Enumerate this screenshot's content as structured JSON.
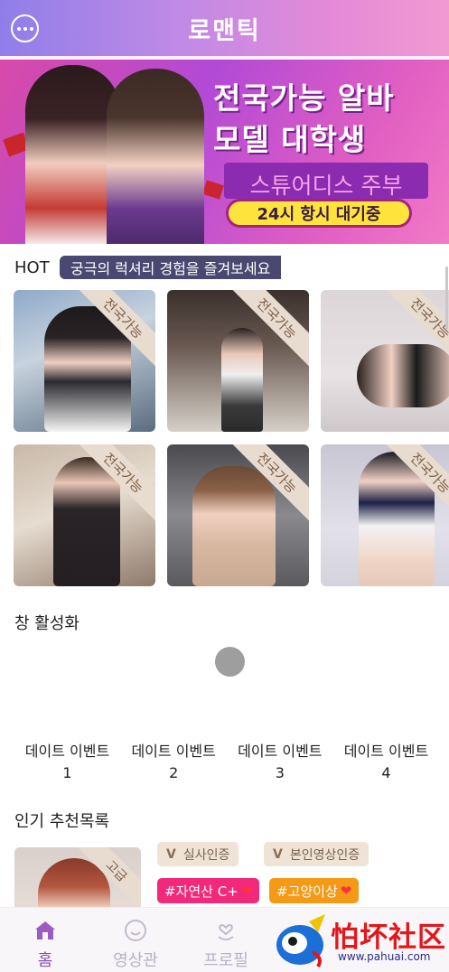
{
  "header": {
    "title": "로맨틱",
    "chat_icon": "chat-bubble-icon"
  },
  "banner": {
    "line1": "전국가능 알바",
    "line2": "모델 대학생",
    "line3": "스튜어디스 주부",
    "pill": "24시 항시 대기중"
  },
  "hot": {
    "label": "HOT",
    "tagline": "궁극의 럭셔리 경험을 즐겨보세요",
    "cards": [
      {
        "ribbon": "전국가능"
      },
      {
        "ribbon": "전국가능"
      },
      {
        "ribbon": "전국가능"
      },
      {
        "ribbon": "전국가능"
      },
      {
        "ribbon": "전국가능"
      },
      {
        "ribbon": "전국가능"
      }
    ]
  },
  "activation": {
    "title": "창 활성화"
  },
  "events": [
    {
      "label": "데이트 이벤트",
      "number": "1"
    },
    {
      "label": "데이트 이벤트",
      "number": "2"
    },
    {
      "label": "데이트 이벤트",
      "number": "3"
    },
    {
      "label": "데이트 이벤트",
      "number": "4"
    }
  ],
  "recommend": {
    "title": "인기 추천목록",
    "ribbon": "고급",
    "badges": [
      {
        "v": "V",
        "label": "실사인증"
      },
      {
        "v": "V",
        "label": "본인영상인증"
      }
    ],
    "tags": [
      {
        "label": "#자연산 C+",
        "color": "#f2297a"
      },
      {
        "label": "#고양이상",
        "color": "#f59a17"
      }
    ]
  },
  "nav": {
    "items": [
      {
        "label": "홈",
        "icon": "home-icon"
      },
      {
        "label": "영상관",
        "icon": "smile-icon"
      },
      {
        "label": "프로필",
        "icon": "heart-hand-icon"
      }
    ]
  },
  "watermark": {
    "text": "怕坏社区",
    "url": "www.pahuai.com"
  },
  "colors": {
    "accent": "#8a4fb0",
    "header_start": "#8f7ee8",
    "header_end": "#f19ad2"
  }
}
